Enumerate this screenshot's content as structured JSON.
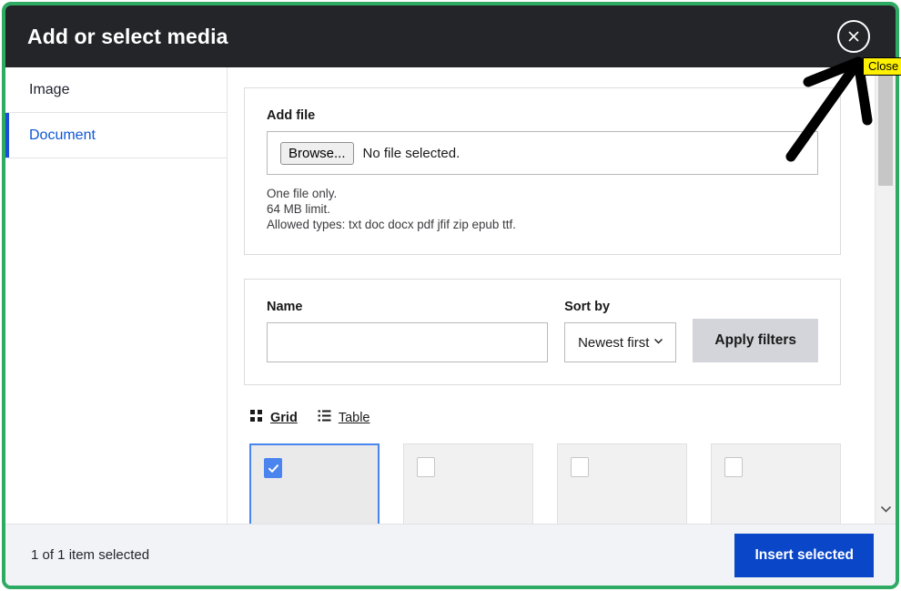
{
  "dialog": {
    "title": "Add or select media",
    "close_label": "Close",
    "close_icon": "close-circle-icon"
  },
  "sidebar": {
    "items": [
      {
        "label": "Image",
        "active": false
      },
      {
        "label": "Document",
        "active": true
      }
    ]
  },
  "add_file": {
    "label": "Add file",
    "browse_label": "Browse...",
    "no_file_text": "No file selected.",
    "help": [
      "One file only.",
      "64 MB limit.",
      "Allowed types: txt doc docx pdf jfif zip epub ttf."
    ]
  },
  "filters": {
    "name_label": "Name",
    "name_value": "",
    "name_placeholder": "",
    "sort_label": "Sort by",
    "sort_value": "Newest first",
    "sort_chevron_icon": "chevron-down-icon",
    "apply_label": "Apply filters"
  },
  "view_toggle": {
    "grid_label": "Grid",
    "grid_icon": "grid-icon",
    "table_label": "Table",
    "table_icon": "list-icon",
    "active": "Grid"
  },
  "media_grid": {
    "cards": [
      {
        "selected": true
      },
      {
        "selected": false
      },
      {
        "selected": false
      },
      {
        "selected": false
      }
    ]
  },
  "scrollbar": {
    "down_arrow_icon": "chevron-down-icon"
  },
  "footer": {
    "status": "1 of 1 item selected",
    "insert_label": "Insert selected"
  },
  "annotation": {
    "arrow_icon": "arrow-up-right-icon",
    "tooltip": "Close"
  },
  "colors": {
    "frame_green": "#2eaa63",
    "header_dark": "#232529",
    "accent_blue": "#0a46c8",
    "tab_active_blue": "#1a4fd6",
    "select_blue": "#4a84ef",
    "tooltip_yellow": "#fdf000",
    "footer_gray": "#f1f3f7"
  }
}
